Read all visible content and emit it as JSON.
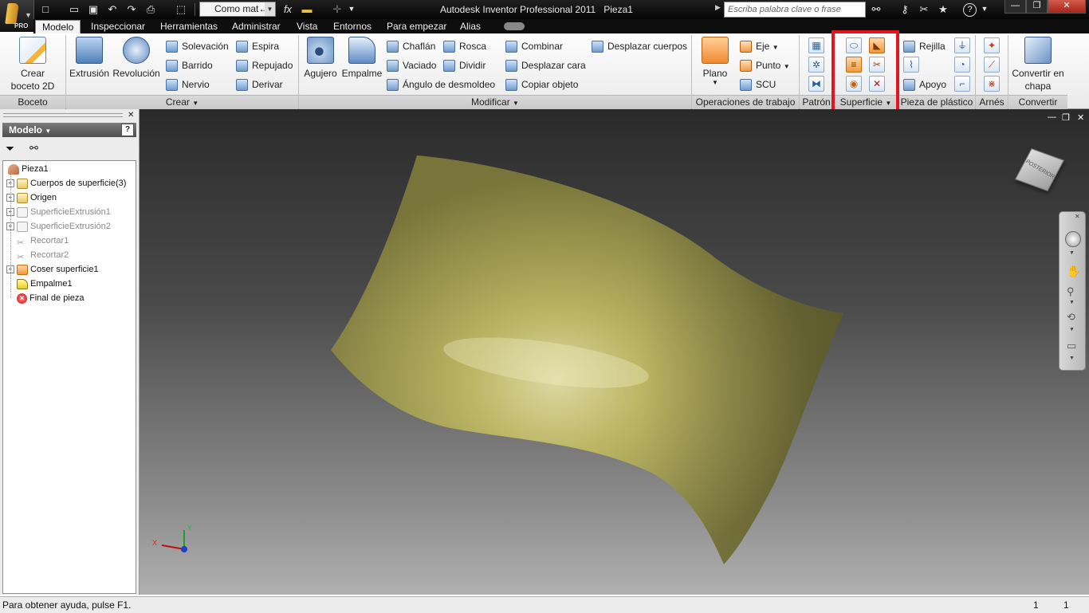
{
  "window": {
    "app_name": "Autodesk Inventor Professional 2011",
    "document_name": "Pieza1",
    "app_edition": "PRO"
  },
  "quick_access": {
    "material_value": "Como mat←",
    "fx_label": "fx"
  },
  "search": {
    "placeholder": "Escriba palabra clave o frase"
  },
  "tabs": [
    {
      "label": "Modelo",
      "active": true
    },
    {
      "label": "Inspeccionar"
    },
    {
      "label": "Herramientas"
    },
    {
      "label": "Administrar"
    },
    {
      "label": "Vista"
    },
    {
      "label": "Entornos"
    },
    {
      "label": "Para empezar"
    },
    {
      "label": "Alias"
    }
  ],
  "ribbon": {
    "boceto": {
      "panel": "Boceto",
      "create_sketch_line1": "Crear",
      "create_sketch_line2": "boceto 2D"
    },
    "crear": {
      "panel": "Crear",
      "extrusion": "Extrusión",
      "revolucion": "Revolución",
      "solevacion": "Solevación",
      "barrido": "Barrido",
      "nervio": "Nervio",
      "espira": "Espira",
      "repujado": "Repujado",
      "derivar": "Derivar"
    },
    "modificar": {
      "panel": "Modificar",
      "agujero": "Agujero",
      "empalme": "Empalme",
      "chaflan": "Chaflán",
      "vaciado": "Vaciado",
      "desmoldeo": "Ángulo de desmoldeo",
      "rosca": "Rosca",
      "dividir": "Dividir",
      "combinar": "Combinar",
      "desplazar_cara": "Desplazar cara",
      "copiar_objeto": "Copiar objeto",
      "desplazar_cuerpos": "Desplazar cuerpos"
    },
    "trabajo": {
      "panel": "Operaciones de trabajo",
      "plano": "Plano",
      "eje": "Eje",
      "punto": "Punto",
      "scu": "SCU"
    },
    "patron": {
      "panel": "Patrón"
    },
    "superficie": {
      "panel": "Superficie"
    },
    "plastico": {
      "panel": "Pieza de plástico",
      "rejilla": "Rejilla",
      "apoyo": "Apoyo"
    },
    "arnes": {
      "panel": "Arnés"
    },
    "convertir": {
      "panel": "Convertir",
      "line1": "Convertir en",
      "line2": "chapa"
    }
  },
  "browser": {
    "title": "Modelo",
    "items": [
      {
        "label": "Pieza1",
        "icon": "part-icon",
        "expander": false,
        "dim": false,
        "level": 0
      },
      {
        "label": "Cuerpos de superficie(3)",
        "icon": "folder-icon",
        "expander": true,
        "dim": false,
        "level": 1
      },
      {
        "label": "Origen",
        "icon": "folder-icon",
        "expander": true,
        "dim": false,
        "level": 1
      },
      {
        "label": "SuperficieExtrusión1",
        "icon": "surface-extrusion-icon",
        "expander": true,
        "dim": true,
        "level": 1
      },
      {
        "label": "SuperficieExtrusión2",
        "icon": "surface-extrusion-icon",
        "expander": true,
        "dim": true,
        "level": 1
      },
      {
        "label": "Recortar1",
        "icon": "trim-icon",
        "expander": false,
        "dim": true,
        "level": 1
      },
      {
        "label": "Recortar2",
        "icon": "trim-icon",
        "expander": false,
        "dim": true,
        "level": 1
      },
      {
        "label": "Coser superficie1",
        "icon": "stitch-icon",
        "expander": true,
        "dim": false,
        "level": 1
      },
      {
        "label": "Empalme1",
        "icon": "fillet-icon",
        "expander": false,
        "dim": false,
        "level": 1
      },
      {
        "label": "Final de pieza",
        "icon": "end-of-part-icon",
        "expander": false,
        "dim": false,
        "level": 1
      }
    ]
  },
  "viewport": {
    "viewcube_label": "POSTERIOR",
    "triad": {
      "x": "X",
      "y": "Y",
      "z": "Z"
    }
  },
  "status": {
    "help_text": "Para obtener ayuda, pulse F1.",
    "count_a": "1",
    "count_b": "1"
  },
  "colors": {
    "surface": "#b9b255",
    "highlight": "#e2141f",
    "title_bar": "#0e0e0e"
  }
}
